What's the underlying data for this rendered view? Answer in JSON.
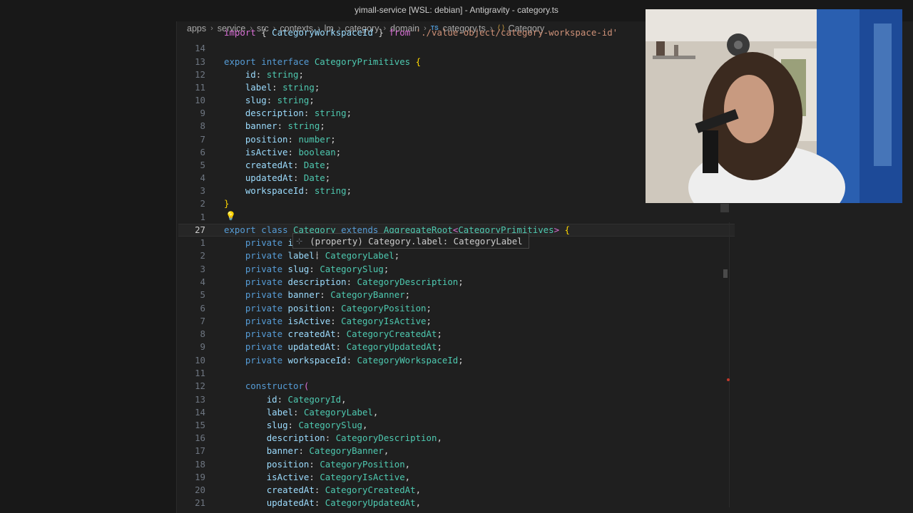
{
  "window": {
    "title": "yimall-service [WSL: debian] - Antigravity - category.ts"
  },
  "breadcrumb": {
    "items": [
      "apps",
      "service",
      "src",
      "contexts",
      "lm",
      "category",
      "domain"
    ],
    "file_badge": "TS",
    "file": "category.ts",
    "symbol": "Category"
  },
  "hover": {
    "text": "(property) Category.label: CategoryLabel"
  },
  "webcam": {
    "description": "presenter webcam overlay"
  }
}
